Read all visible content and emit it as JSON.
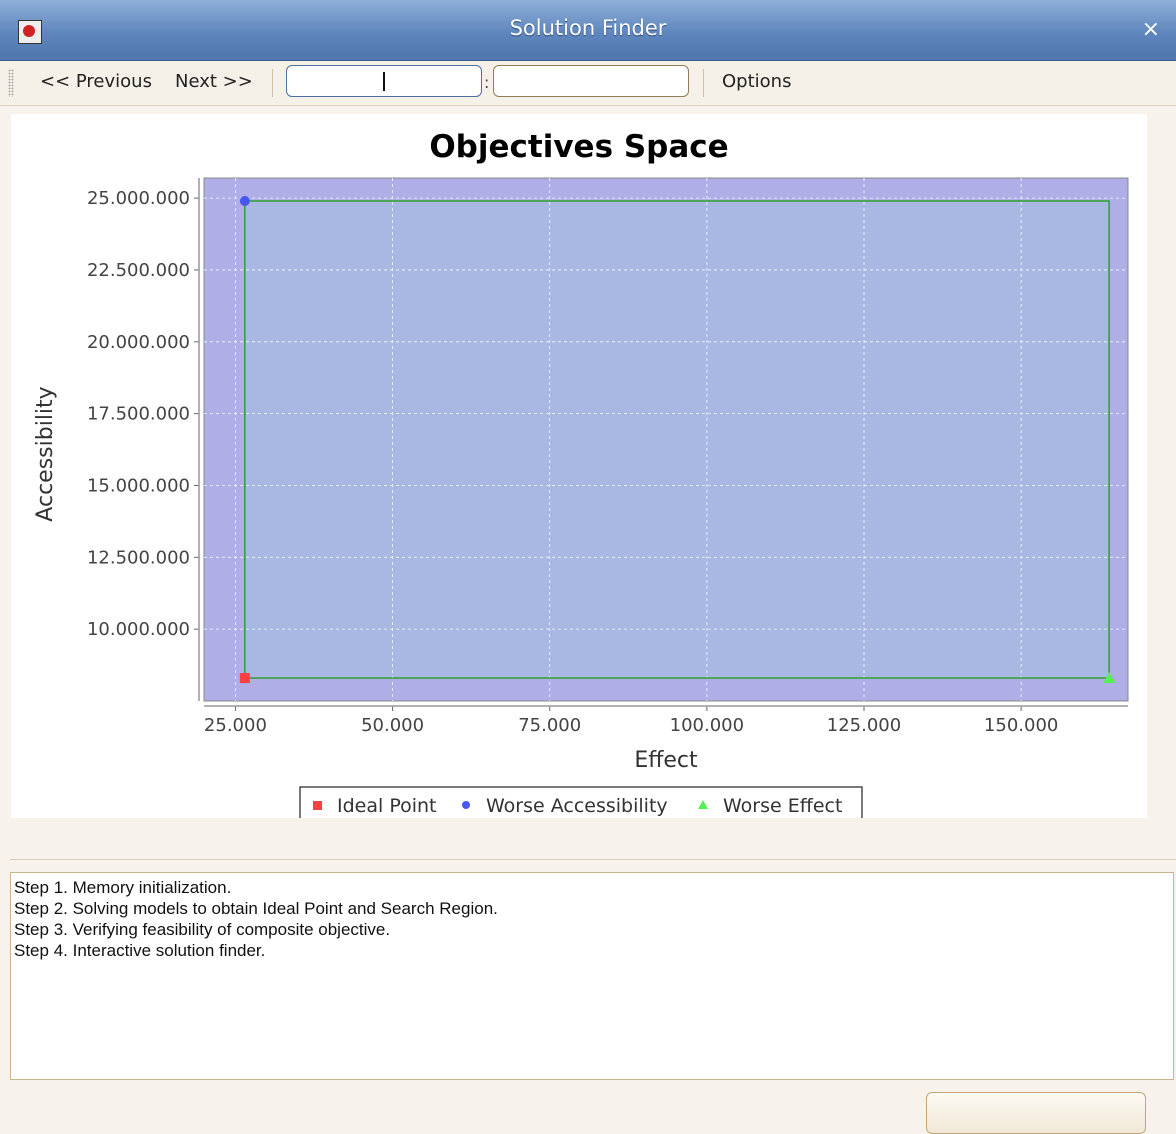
{
  "window": {
    "title": "Solution Finder",
    "close_symbol": "×"
  },
  "toolbar": {
    "previous_label": "<< Previous",
    "next_label": "Next >>",
    "field1_value": "",
    "separator_colon": ":",
    "field2_value": "",
    "options_label": "Options"
  },
  "chart_data": {
    "type": "scatter",
    "title": "Objectives Space",
    "xlabel": "Effect",
    "ylabel": "Accessibility",
    "xlim": [
      20000,
      167000
    ],
    "ylim": [
      7500000,
      25700000
    ],
    "xticks": [
      25000,
      50000,
      75000,
      100000,
      125000,
      150000
    ],
    "xtick_labels": [
      "25.000",
      "50.000",
      "75.000",
      "100.000",
      "125.000",
      "150.000"
    ],
    "yticks": [
      10000000,
      12500000,
      15000000,
      17500000,
      20000000,
      22500000,
      25000000
    ],
    "ytick_labels": [
      "10.000.000",
      "12.500.000",
      "15.000.000",
      "17.500.000",
      "20.000.000",
      "22.500.000",
      "25.000.000"
    ],
    "grid": true,
    "legend_placement": "bottom",
    "background": "#b0aee6",
    "search_region": {
      "x_min": 26500,
      "x_max": 164000,
      "y_min": 8300000,
      "y_max": 24900000,
      "fill": "#a9b8e2",
      "stroke": "#2ea02e"
    },
    "series": [
      {
        "name": "Ideal Point",
        "marker": "square",
        "color": "#ff4040",
        "points": [
          [
            26500,
            8300000
          ]
        ]
      },
      {
        "name": "Worse Accessibility",
        "marker": "circle",
        "color": "#4a56f0",
        "points": [
          [
            26500,
            24900000
          ]
        ]
      },
      {
        "name": "Worse Effect",
        "marker": "triangle",
        "color": "#55ee55",
        "points": [
          [
            164000,
            8300000
          ]
        ]
      }
    ]
  },
  "log": {
    "lines": [
      "Step 1. Memory initialization.",
      "Step 2. Solving models to obtain Ideal Point and Search Region.",
      "Step 3. Verifying feasibility of composite objective.",
      "Step 4. Interactive solution finder."
    ]
  }
}
